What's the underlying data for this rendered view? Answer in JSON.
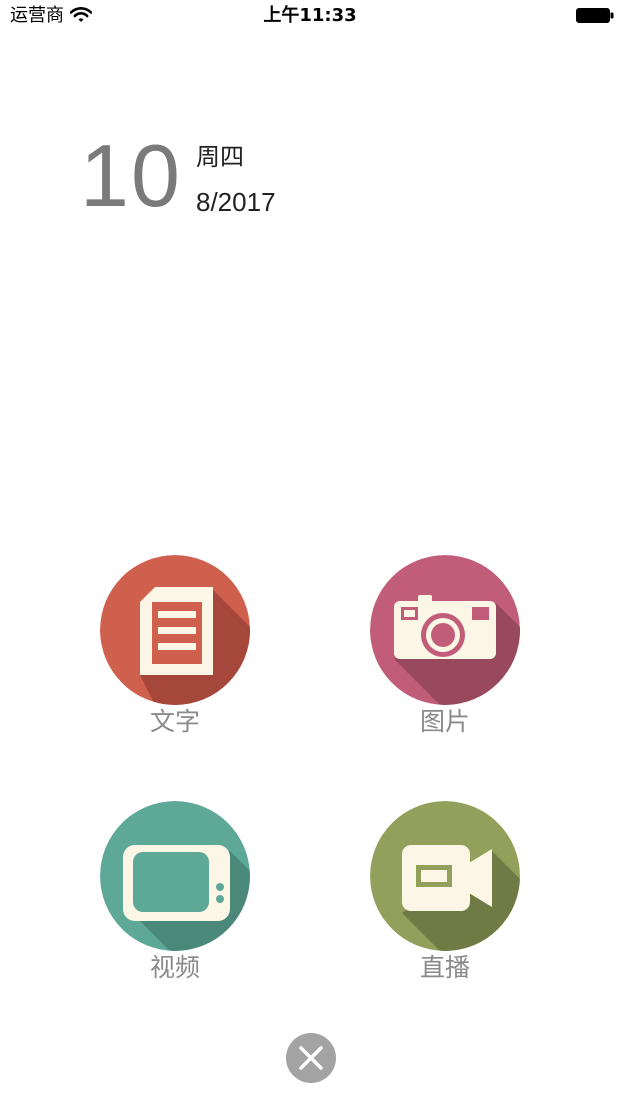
{
  "status_bar": {
    "carrier": "运营商",
    "time": "上午11:33",
    "wifi_icon": "wifi-icon",
    "battery_icon": "battery-icon"
  },
  "date": {
    "day": "10",
    "weekday": "周四",
    "month_year": "8/2017"
  },
  "menu": {
    "items": [
      {
        "label": "文字",
        "icon": "document-icon",
        "color": "#d0604e"
      },
      {
        "label": "图片",
        "icon": "camera-icon",
        "color": "#c25d79"
      },
      {
        "label": "视频",
        "icon": "tv-icon",
        "color": "#5ea898"
      },
      {
        "label": "直播",
        "icon": "video-camera-icon",
        "color": "#93a05b"
      }
    ]
  },
  "close_button": {
    "icon": "close-icon"
  }
}
